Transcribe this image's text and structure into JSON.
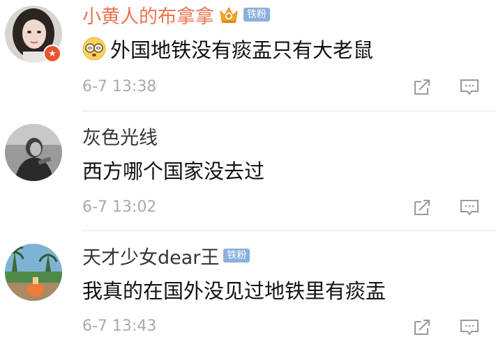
{
  "colors": {
    "vip_name": "#eb7350",
    "name": "#333333",
    "text": "#111111",
    "timestamp": "#aaaaaa",
    "fan_badge": "#8bb0dd",
    "divider": "#e6e6e6"
  },
  "comments": [
    {
      "username": "小黄人的布拿拿",
      "name_style": "vip",
      "crown_icon": "crown-icon",
      "badge": "铁粉",
      "emoji": "dizzy-glasses-emoji",
      "text": "外国地铁没有痰盂只有大老鼠",
      "time": "6-7 13:38"
    },
    {
      "username": "灰色光线",
      "name_style": "normal",
      "text": "西方哪个国家没去过",
      "time": "6-7 13:02"
    },
    {
      "username": "天才少女dear王",
      "name_style": "normal",
      "badge": "铁粉",
      "text": "我真的在国外没见过地铁里有痰盂",
      "time": "6-7 13:43"
    }
  ],
  "actions": {
    "share_icon": "share-icon",
    "reply_icon": "reply-icon"
  }
}
